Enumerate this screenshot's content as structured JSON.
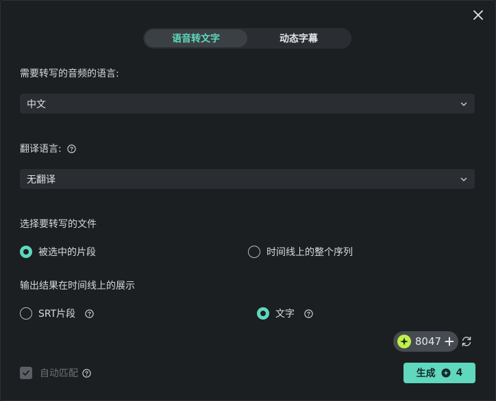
{
  "tabs": [
    {
      "label": "语音转文字",
      "active": true
    },
    {
      "label": "动态字幕",
      "active": false
    }
  ],
  "source_language": {
    "label": "需要转写的音频的语言:",
    "value": "中文"
  },
  "translation": {
    "label": "翻译语言:",
    "value": "无翻译"
  },
  "file_selection": {
    "label": "选择要转写的文件",
    "options": [
      {
        "label": "被选中的片段",
        "checked": true
      },
      {
        "label": "时间线上的整个序列",
        "checked": false
      }
    ]
  },
  "output": {
    "label": "输出结果在时间线上的展示",
    "options": [
      {
        "label": "SRT片段",
        "checked": false
      },
      {
        "label": "文字",
        "checked": true
      }
    ]
  },
  "credits": {
    "value": "8047"
  },
  "auto_match": {
    "label": "自动匹配",
    "checked": true,
    "disabled": true
  },
  "generate": {
    "label": "生成",
    "cost": "4"
  },
  "colors": {
    "accent": "#5fd8bd",
    "background": "#1c1f22",
    "field": "#2a2e32",
    "credit_gem": "#bff04a"
  }
}
